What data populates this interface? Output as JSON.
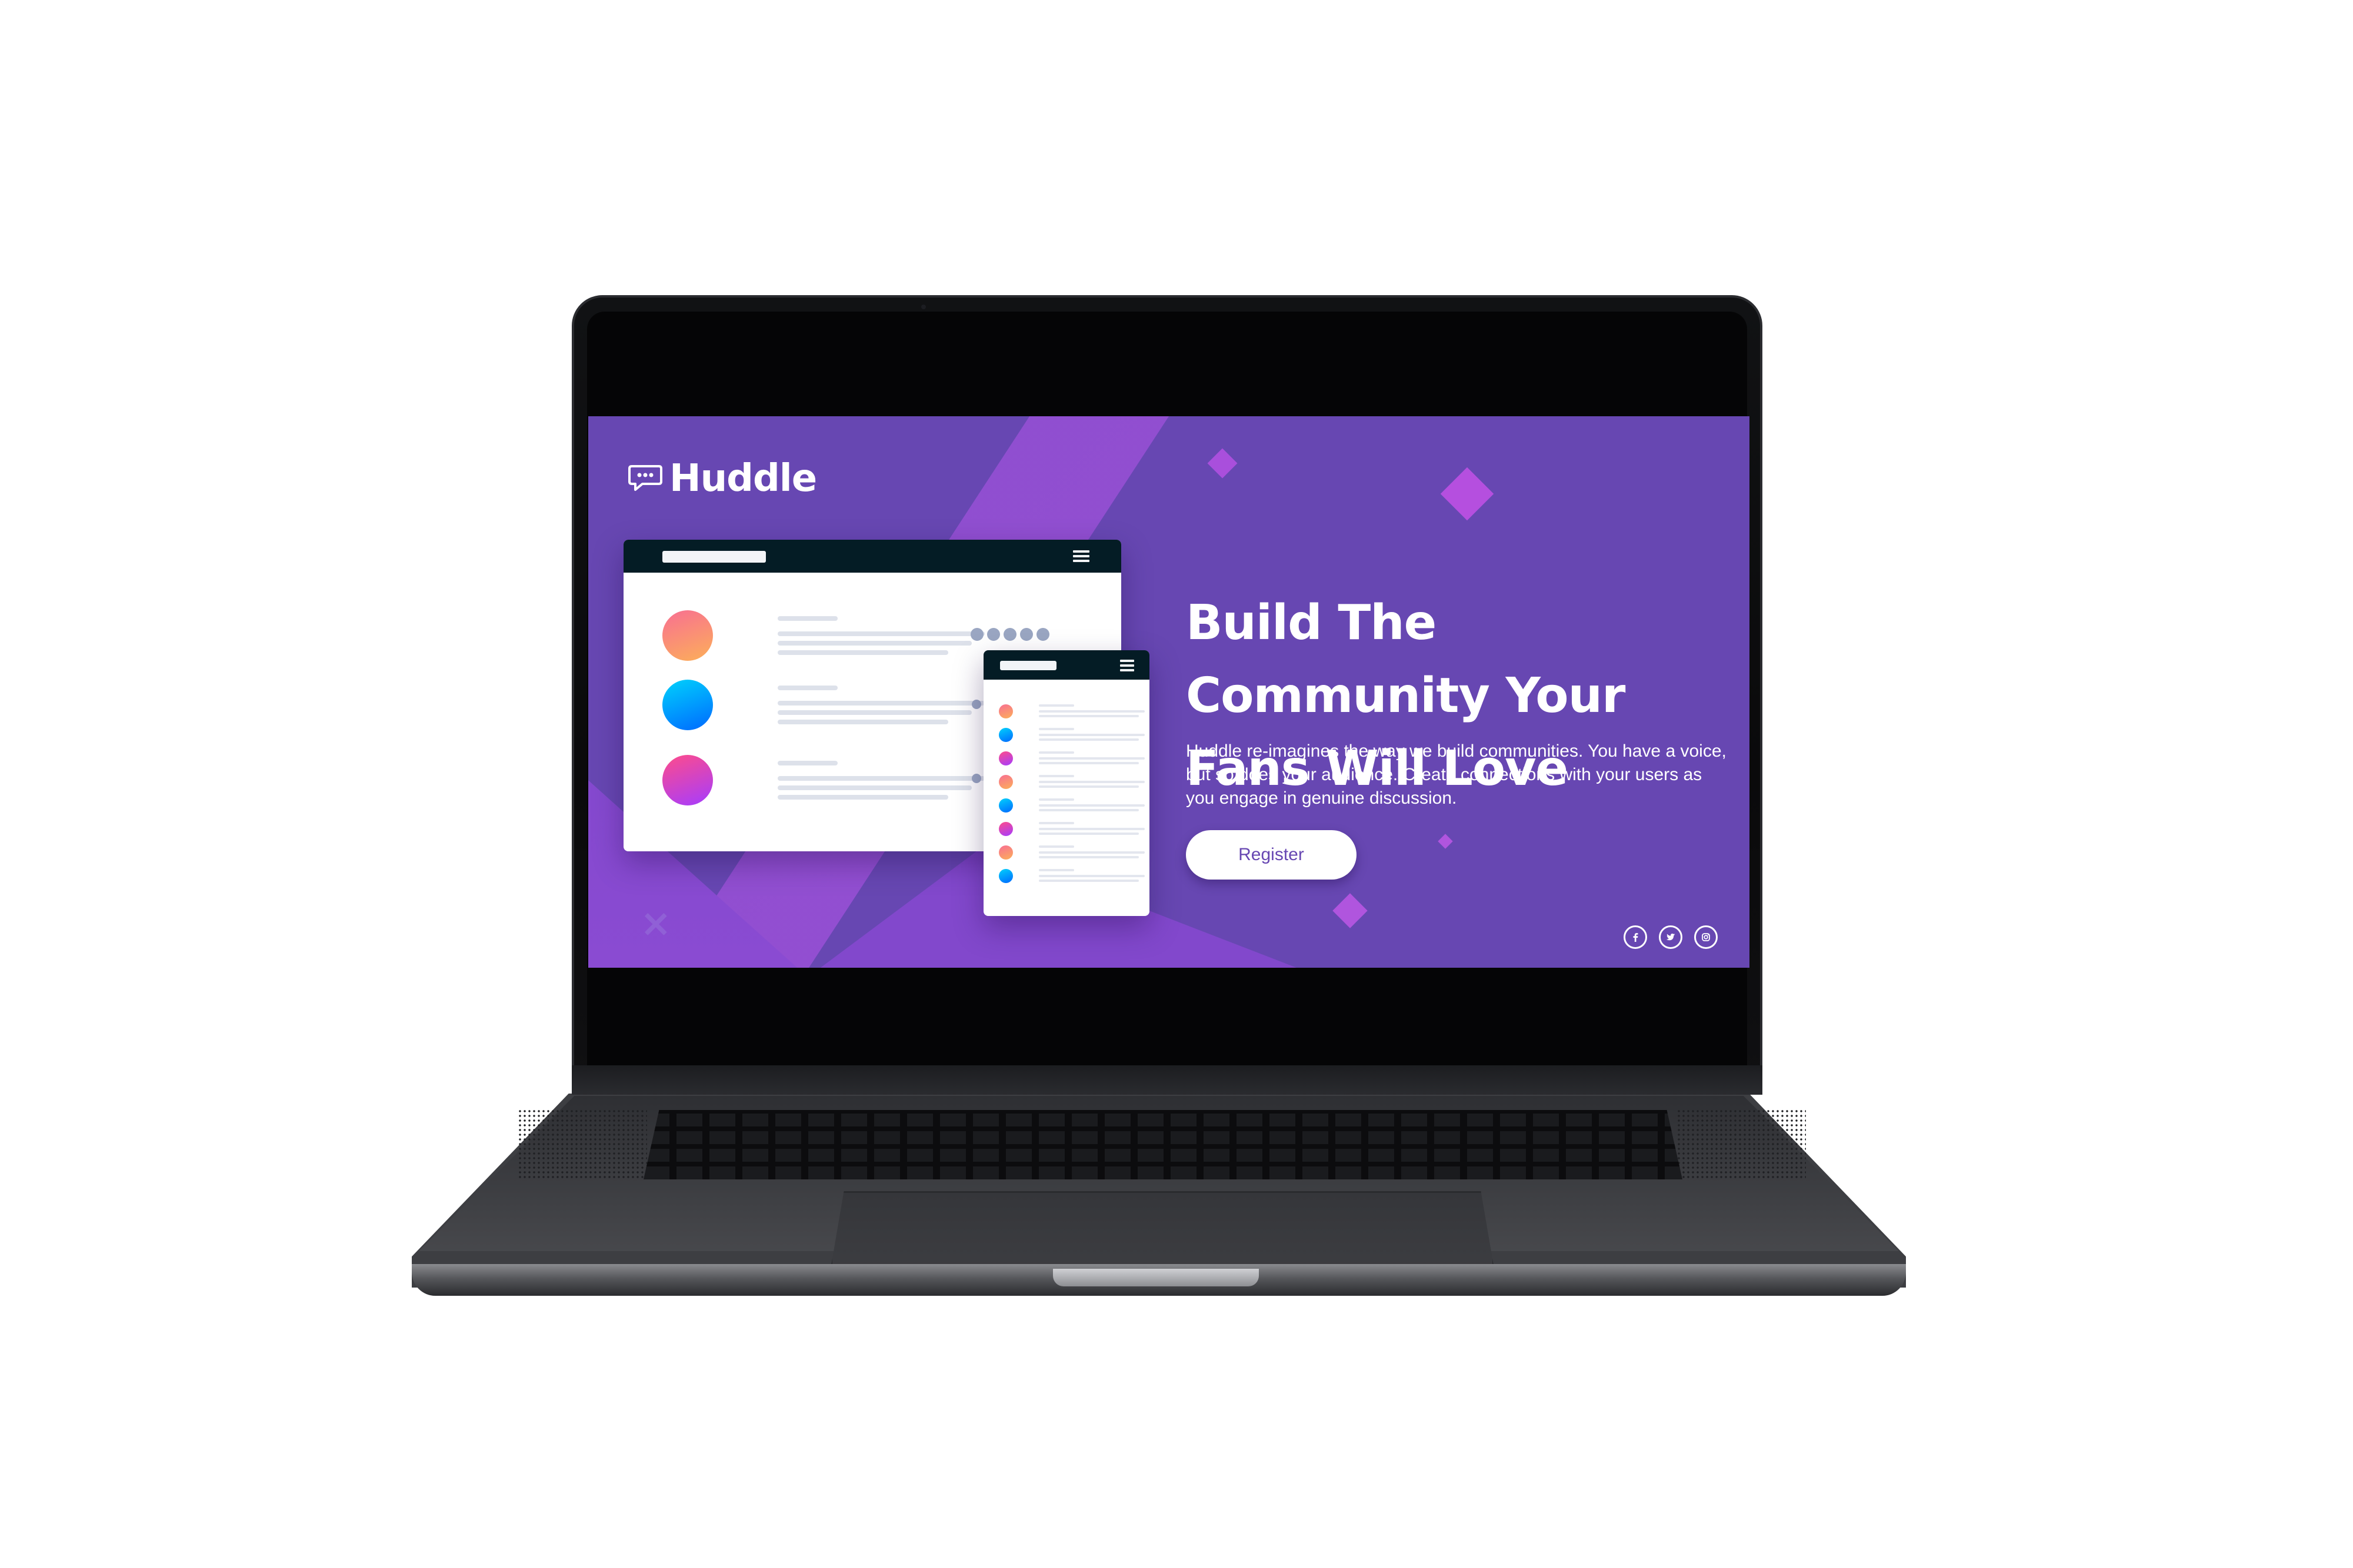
{
  "brand": {
    "name": "Huddle",
    "logo_icon": "chat-bubble-icon"
  },
  "hero": {
    "headline": "Build The Community Your Fans Will Love",
    "description": "Huddle re-imagines the way we build communities. You have a voice, but so does your audience. Create connections with your users as you engage in genuine discussion.",
    "register_label": "Register"
  },
  "social": [
    {
      "name": "facebook",
      "icon": "facebook-icon"
    },
    {
      "name": "twitter",
      "icon": "twitter-icon"
    },
    {
      "name": "instagram",
      "icon": "instagram-icon"
    }
  ],
  "colors": {
    "background": "#6747b2",
    "accent": "#9b4fd6",
    "button_text": "#6747b2",
    "mock_header": "#041c25"
  }
}
